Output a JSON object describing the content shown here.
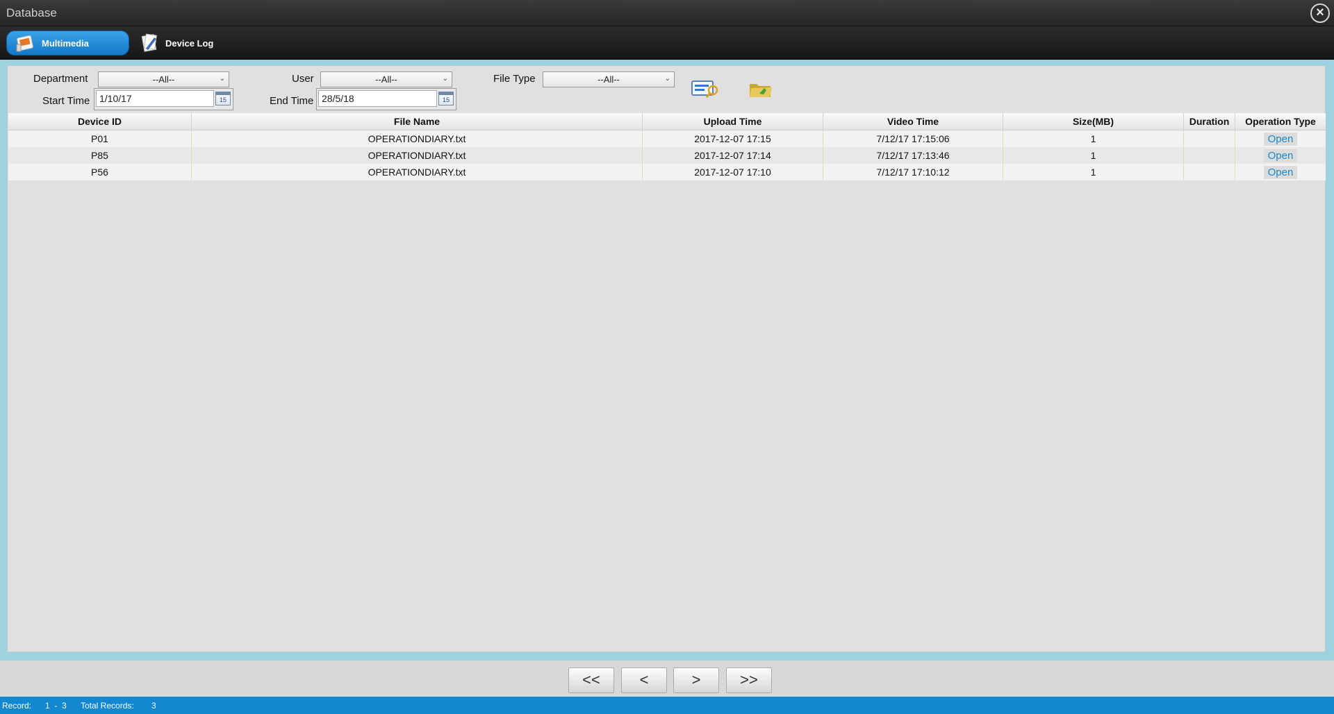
{
  "window": {
    "title": "Database"
  },
  "tabs": [
    {
      "label": "Multimedia",
      "active": true
    },
    {
      "label": "Device Log",
      "active": false
    }
  ],
  "filters": {
    "department_label": "Department",
    "department_value": "--All--",
    "user_label": "User",
    "user_value": "--All--",
    "filetype_label": "File Type",
    "filetype_value": "--All--",
    "start_label": "Start Time",
    "start_value": "1/10/17",
    "end_label": "End Time",
    "end_value": "28/5/18",
    "calendar_day": "15"
  },
  "table": {
    "columns": [
      "Device ID",
      "File Name",
      "Upload Time",
      "Video Time",
      "Size(MB)",
      "Duration",
      "Operation Type"
    ],
    "rows": [
      {
        "device_id": "P01",
        "file_name": "OPERATIONDIARY.txt",
        "upload_time": "2017-12-07 17:15",
        "video_time": "7/12/17 17:15:06",
        "size": "1",
        "duration": "",
        "operation": "Open"
      },
      {
        "device_id": "P85",
        "file_name": "OPERATIONDIARY.txt",
        "upload_time": "2017-12-07 17:14",
        "video_time": "7/12/17 17:13:46",
        "size": "1",
        "duration": "",
        "operation": "Open"
      },
      {
        "device_id": "P56",
        "file_name": "OPERATIONDIARY.txt",
        "upload_time": "2017-12-07 17:10",
        "video_time": "7/12/17 17:10:12",
        "size": "1",
        "duration": "",
        "operation": "Open"
      }
    ]
  },
  "pager": {
    "first": "<<",
    "prev": "<",
    "next": ">",
    "last": ">>"
  },
  "status": {
    "record_label": "Record:",
    "record_range": "1  -  3",
    "total_label": "Total Records:",
    "total_value": "3"
  },
  "colors": {
    "accent": "#1387d0",
    "link": "#1b86c9",
    "titlebar": "#262626"
  },
  "icons": [
    "close-icon",
    "multimedia-icon",
    "device-log-icon",
    "calendar-icon",
    "search-icon",
    "export-folder-icon"
  ]
}
